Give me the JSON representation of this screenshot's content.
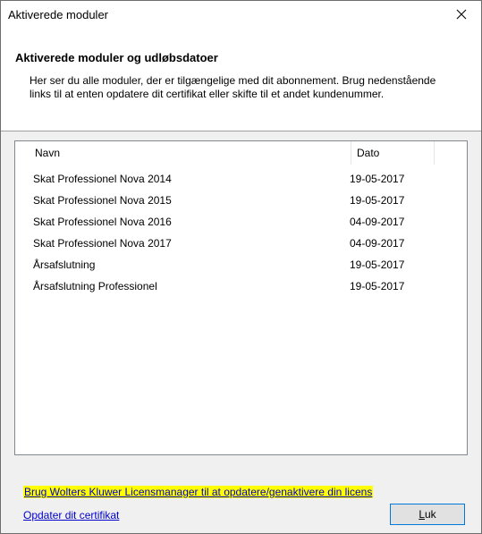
{
  "window": {
    "title": "Aktiverede moduler"
  },
  "header": {
    "title": "Aktiverede moduler og udløbsdatoer",
    "description": "Her ser du alle moduler, der er tilgængelige med dit abonnement. Brug nedenstående links til at enten opdatere dit certifikat eller skifte til et andet kundenummer."
  },
  "table": {
    "columns": {
      "name": "Navn",
      "date": "Dato"
    },
    "rows": [
      {
        "name": "Skat Professionel Nova 2014",
        "date": "19-05-2017"
      },
      {
        "name": "Skat Professionel Nova 2015",
        "date": "19-05-2017"
      },
      {
        "name": "Skat Professionel Nova 2016",
        "date": "04-09-2017"
      },
      {
        "name": "Skat Professionel Nova 2017",
        "date": "04-09-2017"
      },
      {
        "name": "Årsafslutning",
        "date": "19-05-2017"
      },
      {
        "name": "Årsafslutning Professionel",
        "date": "19-05-2017"
      }
    ]
  },
  "links": {
    "licens": "Brug Wolters Kluwer Licensmanager til at opdatere/genaktivere din licens",
    "certifikat": "Opdater dit certifikat"
  },
  "buttons": {
    "luk_first": "L",
    "luk_rest": "uk"
  },
  "icons": {
    "close": "close-icon"
  },
  "colors": {
    "highlight": "#ffff00",
    "link": "#0000cc",
    "button_border": "#0078d7"
  }
}
